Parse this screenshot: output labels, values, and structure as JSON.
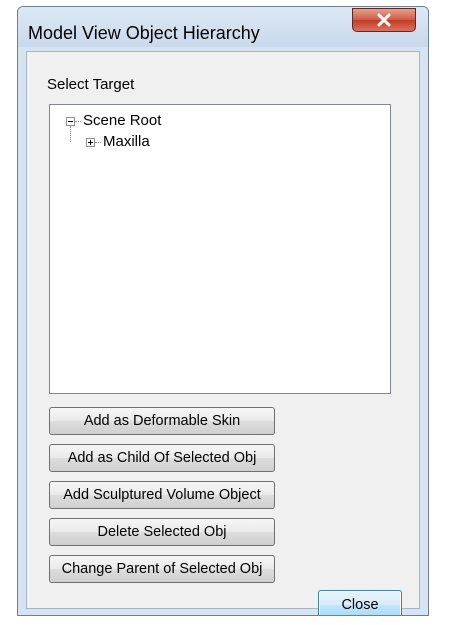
{
  "window": {
    "title": "Model View Object Hierarchy",
    "close_icon": "close-x-icon"
  },
  "panel": {
    "select_label": "Select Target"
  },
  "tree": {
    "items": [
      {
        "label": "Scene Root",
        "state": "expanded"
      },
      {
        "label": "Maxilla",
        "state": "collapsed"
      }
    ]
  },
  "buttons": {
    "add_deformable_skin": "Add as Deformable Skin",
    "add_child": "Add as Child Of Selected Obj",
    "add_sculptured": "Add Sculptured Volume Object",
    "delete_selected": "Delete Selected Obj",
    "change_parent": "Change Parent of Selected Obj",
    "close": "Close"
  },
  "colors": {
    "close_button": "#c43a27",
    "window_frame": "#d6e3f1",
    "client_bg": "#f0f0f0"
  }
}
